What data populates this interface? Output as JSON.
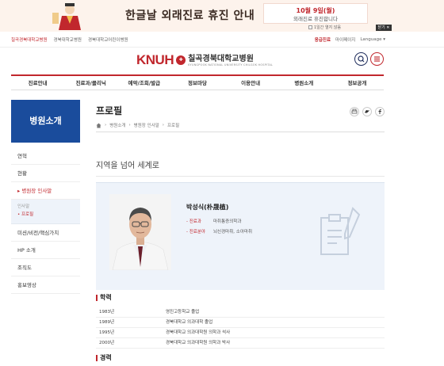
{
  "banner": {
    "title": "한글날 외래진료 휴진 안내",
    "notice_date": "10월 9일(월)",
    "notice_text": "외래진료 휴진합니다",
    "hide_today": "1일간 열지 않음",
    "close": "닫기 ✕"
  },
  "utility": {
    "sites": [
      "칠곡경북대학교병원",
      "경북대학교병원",
      "경북대학교어린이병원"
    ],
    "right": [
      "응급진료",
      "마이페이지",
      "Language ▾"
    ]
  },
  "header": {
    "logo_text": "KNUH",
    "logo_name": "칠곡경북대학교병원",
    "logo_en": "KYUNGPOOK NATIONAL UNIVERSITY CHILGOK HOSPITAL"
  },
  "gnb": [
    "진료안내",
    "진료과/클리닉",
    "예약/조회/발급",
    "정보마당",
    "이용안내",
    "병원소개",
    "정보공개"
  ],
  "sidebar": {
    "title": "병원소개",
    "items": [
      {
        "label": "연혁"
      },
      {
        "label": "현황"
      },
      {
        "label": "병원장 인사말"
      },
      {
        "label": "미션/비전/핵심가치"
      },
      {
        "label": "HP 소개"
      },
      {
        "label": "조직도"
      },
      {
        "label": "홍보영상"
      }
    ],
    "sub": [
      "인사말",
      "프로필"
    ]
  },
  "content": {
    "title": "프로필",
    "breadcrumb": [
      "병원소개",
      "병원장 인사말",
      "프로필"
    ],
    "slogan": "지역을 넘어 세계로",
    "doctor": {
      "name": "박성식(朴晟植)",
      "dept_key": "진료과",
      "dept_val": "마취통증의학과",
      "field_key": "진료분야",
      "field_val": "뇌신경마취, 소아마취"
    },
    "education_title": "학력",
    "education": [
      {
        "year": "1983년",
        "text": "영진고등학교 졸업"
      },
      {
        "year": "1989년",
        "text": "경북대학교 의과대학 졸업"
      },
      {
        "year": "1995년",
        "text": "경북대학교 의과대학원 의학과 석사"
      },
      {
        "year": "2000년",
        "text": "경북대학교 의과대학원 의학과 박사"
      }
    ],
    "career_title": "경력"
  },
  "colors": {
    "accent": "#c1272d",
    "navy": "#1a4c9c",
    "card_bg": "#eef3fa"
  },
  "icons": [
    "home-icon",
    "print-icon",
    "twitter-icon",
    "facebook-icon",
    "search-icon",
    "menu-icon",
    "document-pen-icon"
  ]
}
